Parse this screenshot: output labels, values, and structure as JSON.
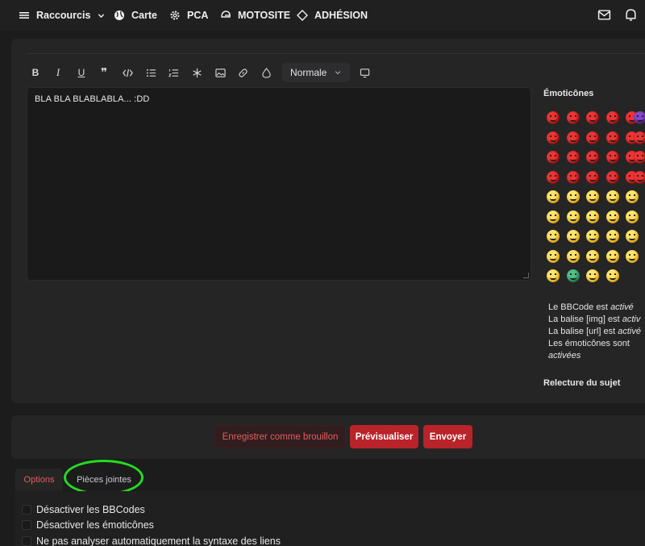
{
  "nav": {
    "shortcuts": "Raccourcis",
    "map": "Carte",
    "pca": "PCA",
    "motosite": "MOTOSITE",
    "adhesion": "ADHÉSION"
  },
  "toolbar": {
    "heading_select": "Normale"
  },
  "editor": {
    "content": "BLA BLA BLABLABLA... :DD"
  },
  "sidebar": {
    "emoticons_title": "Émoticônes",
    "info": {
      "bbcode_prefix": "Le BBCode est ",
      "bbcode_state": "activé",
      "img_prefix": "La balise [img] est ",
      "img_state": "activ",
      "url_prefix": "La balise [url] est ",
      "url_state": "activé",
      "emoticons_line1": "Les émoticônes sont",
      "emoticons_state": "activées"
    },
    "review_title": "Relecture du sujet"
  },
  "actions": {
    "save_draft": "Enregistrer comme brouillon",
    "preview": "Prévisualiser",
    "send": "Envoyer"
  },
  "tabs": [
    {
      "label": "Options"
    },
    {
      "label": "Pièces jointes"
    }
  ],
  "options": [
    {
      "label": "Désactiver les BBCodes"
    },
    {
      "label": "Désactiver les émoticônes"
    },
    {
      "label": "Ne pas analyser automatiquement la syntaxe des liens"
    }
  ],
  "colors": {
    "accent": "#b9232a",
    "highlight": "#22dd22"
  }
}
